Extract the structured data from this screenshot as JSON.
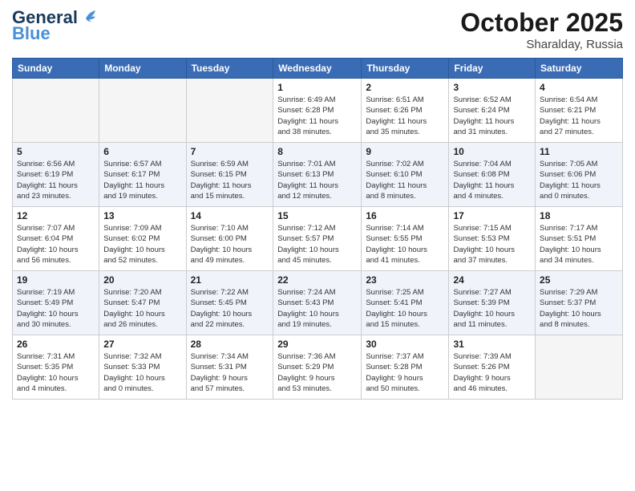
{
  "header": {
    "logo_line1": "General",
    "logo_line2": "Blue",
    "month": "October 2025",
    "location": "Sharalday, Russia"
  },
  "weekdays": [
    "Sunday",
    "Monday",
    "Tuesday",
    "Wednesday",
    "Thursday",
    "Friday",
    "Saturday"
  ],
  "weeks": [
    [
      {
        "day": "",
        "info": ""
      },
      {
        "day": "",
        "info": ""
      },
      {
        "day": "",
        "info": ""
      },
      {
        "day": "1",
        "info": "Sunrise: 6:49 AM\nSunset: 6:28 PM\nDaylight: 11 hours\nand 38 minutes."
      },
      {
        "day": "2",
        "info": "Sunrise: 6:51 AM\nSunset: 6:26 PM\nDaylight: 11 hours\nand 35 minutes."
      },
      {
        "day": "3",
        "info": "Sunrise: 6:52 AM\nSunset: 6:24 PM\nDaylight: 11 hours\nand 31 minutes."
      },
      {
        "day": "4",
        "info": "Sunrise: 6:54 AM\nSunset: 6:21 PM\nDaylight: 11 hours\nand 27 minutes."
      }
    ],
    [
      {
        "day": "5",
        "info": "Sunrise: 6:56 AM\nSunset: 6:19 PM\nDaylight: 11 hours\nand 23 minutes."
      },
      {
        "day": "6",
        "info": "Sunrise: 6:57 AM\nSunset: 6:17 PM\nDaylight: 11 hours\nand 19 minutes."
      },
      {
        "day": "7",
        "info": "Sunrise: 6:59 AM\nSunset: 6:15 PM\nDaylight: 11 hours\nand 15 minutes."
      },
      {
        "day": "8",
        "info": "Sunrise: 7:01 AM\nSunset: 6:13 PM\nDaylight: 11 hours\nand 12 minutes."
      },
      {
        "day": "9",
        "info": "Sunrise: 7:02 AM\nSunset: 6:10 PM\nDaylight: 11 hours\nand 8 minutes."
      },
      {
        "day": "10",
        "info": "Sunrise: 7:04 AM\nSunset: 6:08 PM\nDaylight: 11 hours\nand 4 minutes."
      },
      {
        "day": "11",
        "info": "Sunrise: 7:05 AM\nSunset: 6:06 PM\nDaylight: 11 hours\nand 0 minutes."
      }
    ],
    [
      {
        "day": "12",
        "info": "Sunrise: 7:07 AM\nSunset: 6:04 PM\nDaylight: 10 hours\nand 56 minutes."
      },
      {
        "day": "13",
        "info": "Sunrise: 7:09 AM\nSunset: 6:02 PM\nDaylight: 10 hours\nand 52 minutes."
      },
      {
        "day": "14",
        "info": "Sunrise: 7:10 AM\nSunset: 6:00 PM\nDaylight: 10 hours\nand 49 minutes."
      },
      {
        "day": "15",
        "info": "Sunrise: 7:12 AM\nSunset: 5:57 PM\nDaylight: 10 hours\nand 45 minutes."
      },
      {
        "day": "16",
        "info": "Sunrise: 7:14 AM\nSunset: 5:55 PM\nDaylight: 10 hours\nand 41 minutes."
      },
      {
        "day": "17",
        "info": "Sunrise: 7:15 AM\nSunset: 5:53 PM\nDaylight: 10 hours\nand 37 minutes."
      },
      {
        "day": "18",
        "info": "Sunrise: 7:17 AM\nSunset: 5:51 PM\nDaylight: 10 hours\nand 34 minutes."
      }
    ],
    [
      {
        "day": "19",
        "info": "Sunrise: 7:19 AM\nSunset: 5:49 PM\nDaylight: 10 hours\nand 30 minutes."
      },
      {
        "day": "20",
        "info": "Sunrise: 7:20 AM\nSunset: 5:47 PM\nDaylight: 10 hours\nand 26 minutes."
      },
      {
        "day": "21",
        "info": "Sunrise: 7:22 AM\nSunset: 5:45 PM\nDaylight: 10 hours\nand 22 minutes."
      },
      {
        "day": "22",
        "info": "Sunrise: 7:24 AM\nSunset: 5:43 PM\nDaylight: 10 hours\nand 19 minutes."
      },
      {
        "day": "23",
        "info": "Sunrise: 7:25 AM\nSunset: 5:41 PM\nDaylight: 10 hours\nand 15 minutes."
      },
      {
        "day": "24",
        "info": "Sunrise: 7:27 AM\nSunset: 5:39 PM\nDaylight: 10 hours\nand 11 minutes."
      },
      {
        "day": "25",
        "info": "Sunrise: 7:29 AM\nSunset: 5:37 PM\nDaylight: 10 hours\nand 8 minutes."
      }
    ],
    [
      {
        "day": "26",
        "info": "Sunrise: 7:31 AM\nSunset: 5:35 PM\nDaylight: 10 hours\nand 4 minutes."
      },
      {
        "day": "27",
        "info": "Sunrise: 7:32 AM\nSunset: 5:33 PM\nDaylight: 10 hours\nand 0 minutes."
      },
      {
        "day": "28",
        "info": "Sunrise: 7:34 AM\nSunset: 5:31 PM\nDaylight: 9 hours\nand 57 minutes."
      },
      {
        "day": "29",
        "info": "Sunrise: 7:36 AM\nSunset: 5:29 PM\nDaylight: 9 hours\nand 53 minutes."
      },
      {
        "day": "30",
        "info": "Sunrise: 7:37 AM\nSunset: 5:28 PM\nDaylight: 9 hours\nand 50 minutes."
      },
      {
        "day": "31",
        "info": "Sunrise: 7:39 AM\nSunset: 5:26 PM\nDaylight: 9 hours\nand 46 minutes."
      },
      {
        "day": "",
        "info": ""
      }
    ]
  ]
}
